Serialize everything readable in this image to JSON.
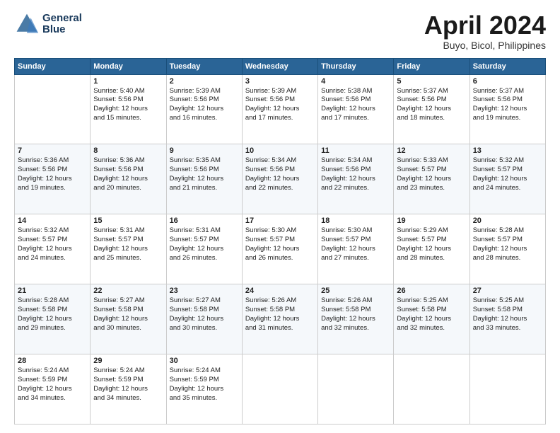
{
  "header": {
    "logo_line1": "General",
    "logo_line2": "Blue",
    "month": "April 2024",
    "location": "Buyo, Bicol, Philippines"
  },
  "weekdays": [
    "Sunday",
    "Monday",
    "Tuesday",
    "Wednesday",
    "Thursday",
    "Friday",
    "Saturday"
  ],
  "weeks": [
    [
      {
        "day": "",
        "info": ""
      },
      {
        "day": "1",
        "info": "Sunrise: 5:40 AM\nSunset: 5:56 PM\nDaylight: 12 hours\nand 15 minutes."
      },
      {
        "day": "2",
        "info": "Sunrise: 5:39 AM\nSunset: 5:56 PM\nDaylight: 12 hours\nand 16 minutes."
      },
      {
        "day": "3",
        "info": "Sunrise: 5:39 AM\nSunset: 5:56 PM\nDaylight: 12 hours\nand 17 minutes."
      },
      {
        "day": "4",
        "info": "Sunrise: 5:38 AM\nSunset: 5:56 PM\nDaylight: 12 hours\nand 17 minutes."
      },
      {
        "day": "5",
        "info": "Sunrise: 5:37 AM\nSunset: 5:56 PM\nDaylight: 12 hours\nand 18 minutes."
      },
      {
        "day": "6",
        "info": "Sunrise: 5:37 AM\nSunset: 5:56 PM\nDaylight: 12 hours\nand 19 minutes."
      }
    ],
    [
      {
        "day": "7",
        "info": "Sunrise: 5:36 AM\nSunset: 5:56 PM\nDaylight: 12 hours\nand 19 minutes."
      },
      {
        "day": "8",
        "info": "Sunrise: 5:36 AM\nSunset: 5:56 PM\nDaylight: 12 hours\nand 20 minutes."
      },
      {
        "day": "9",
        "info": "Sunrise: 5:35 AM\nSunset: 5:56 PM\nDaylight: 12 hours\nand 21 minutes."
      },
      {
        "day": "10",
        "info": "Sunrise: 5:34 AM\nSunset: 5:56 PM\nDaylight: 12 hours\nand 22 minutes."
      },
      {
        "day": "11",
        "info": "Sunrise: 5:34 AM\nSunset: 5:56 PM\nDaylight: 12 hours\nand 22 minutes."
      },
      {
        "day": "12",
        "info": "Sunrise: 5:33 AM\nSunset: 5:57 PM\nDaylight: 12 hours\nand 23 minutes."
      },
      {
        "day": "13",
        "info": "Sunrise: 5:32 AM\nSunset: 5:57 PM\nDaylight: 12 hours\nand 24 minutes."
      }
    ],
    [
      {
        "day": "14",
        "info": "Sunrise: 5:32 AM\nSunset: 5:57 PM\nDaylight: 12 hours\nand 24 minutes."
      },
      {
        "day": "15",
        "info": "Sunrise: 5:31 AM\nSunset: 5:57 PM\nDaylight: 12 hours\nand 25 minutes."
      },
      {
        "day": "16",
        "info": "Sunrise: 5:31 AM\nSunset: 5:57 PM\nDaylight: 12 hours\nand 26 minutes."
      },
      {
        "day": "17",
        "info": "Sunrise: 5:30 AM\nSunset: 5:57 PM\nDaylight: 12 hours\nand 26 minutes."
      },
      {
        "day": "18",
        "info": "Sunrise: 5:30 AM\nSunset: 5:57 PM\nDaylight: 12 hours\nand 27 minutes."
      },
      {
        "day": "19",
        "info": "Sunrise: 5:29 AM\nSunset: 5:57 PM\nDaylight: 12 hours\nand 28 minutes."
      },
      {
        "day": "20",
        "info": "Sunrise: 5:28 AM\nSunset: 5:57 PM\nDaylight: 12 hours\nand 28 minutes."
      }
    ],
    [
      {
        "day": "21",
        "info": "Sunrise: 5:28 AM\nSunset: 5:58 PM\nDaylight: 12 hours\nand 29 minutes."
      },
      {
        "day": "22",
        "info": "Sunrise: 5:27 AM\nSunset: 5:58 PM\nDaylight: 12 hours\nand 30 minutes."
      },
      {
        "day": "23",
        "info": "Sunrise: 5:27 AM\nSunset: 5:58 PM\nDaylight: 12 hours\nand 30 minutes."
      },
      {
        "day": "24",
        "info": "Sunrise: 5:26 AM\nSunset: 5:58 PM\nDaylight: 12 hours\nand 31 minutes."
      },
      {
        "day": "25",
        "info": "Sunrise: 5:26 AM\nSunset: 5:58 PM\nDaylight: 12 hours\nand 32 minutes."
      },
      {
        "day": "26",
        "info": "Sunrise: 5:25 AM\nSunset: 5:58 PM\nDaylight: 12 hours\nand 32 minutes."
      },
      {
        "day": "27",
        "info": "Sunrise: 5:25 AM\nSunset: 5:58 PM\nDaylight: 12 hours\nand 33 minutes."
      }
    ],
    [
      {
        "day": "28",
        "info": "Sunrise: 5:24 AM\nSunset: 5:59 PM\nDaylight: 12 hours\nand 34 minutes."
      },
      {
        "day": "29",
        "info": "Sunrise: 5:24 AM\nSunset: 5:59 PM\nDaylight: 12 hours\nand 34 minutes."
      },
      {
        "day": "30",
        "info": "Sunrise: 5:24 AM\nSunset: 5:59 PM\nDaylight: 12 hours\nand 35 minutes."
      },
      {
        "day": "",
        "info": ""
      },
      {
        "day": "",
        "info": ""
      },
      {
        "day": "",
        "info": ""
      },
      {
        "day": "",
        "info": ""
      }
    ]
  ]
}
